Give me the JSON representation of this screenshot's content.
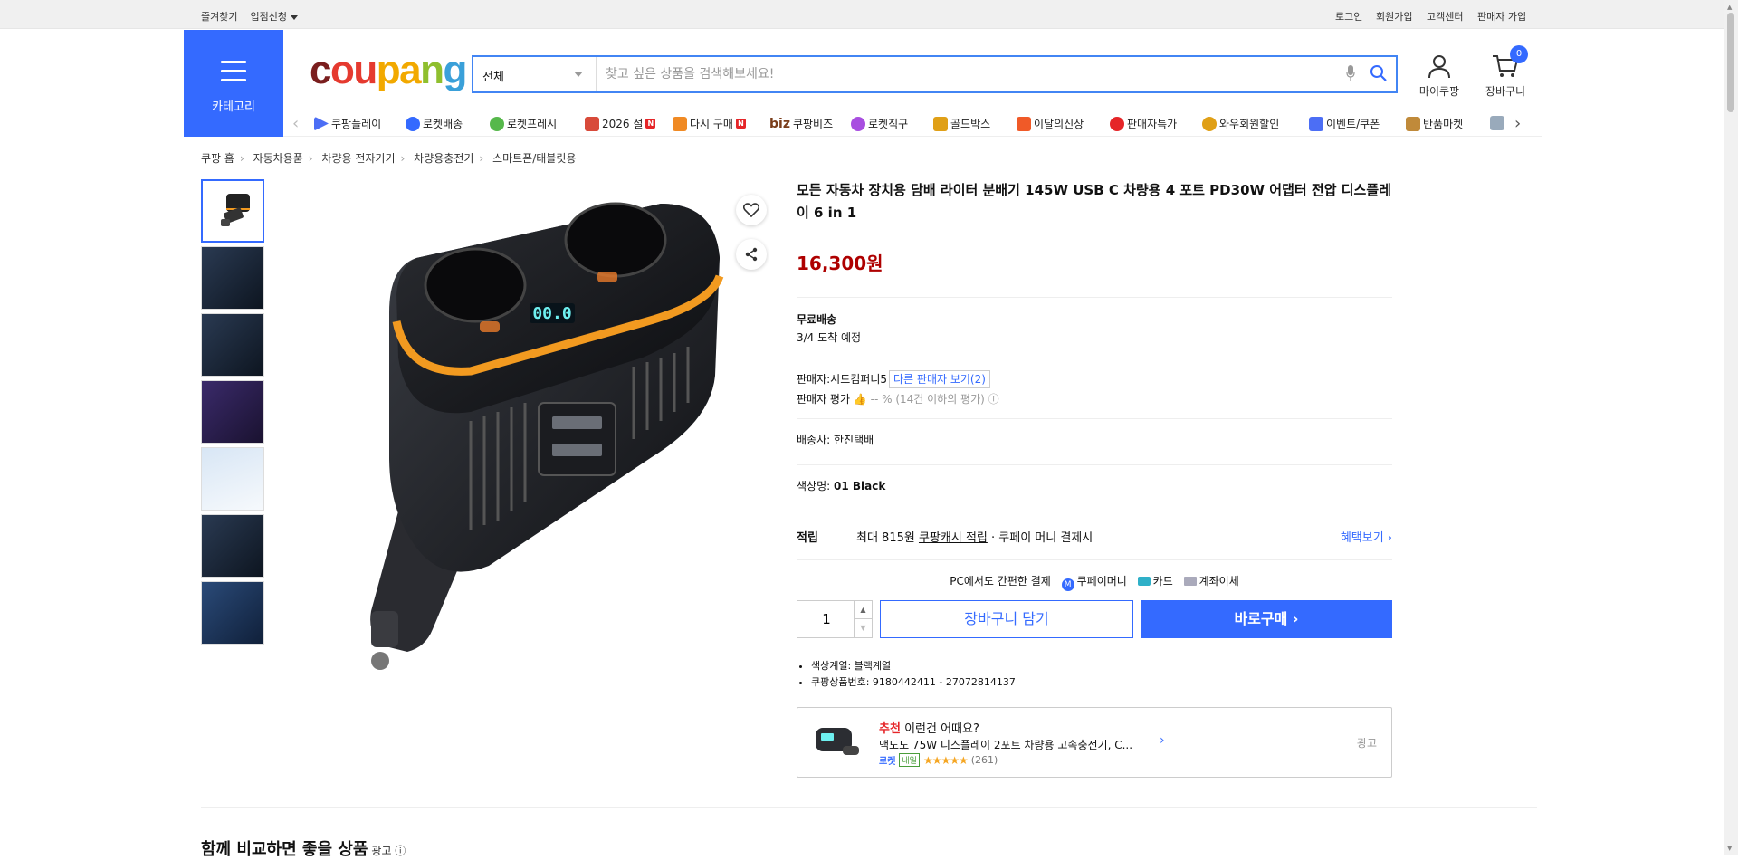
{
  "topbar": {
    "bookmark": "즐겨찾기",
    "join_seller": "입점신청",
    "login": "로그인",
    "signup": "회원가입",
    "customer_center": "고객센터",
    "seller_signup": "판매자 가입"
  },
  "header": {
    "category_label": "카테고리",
    "logo": {
      "p1": "c",
      "p2": "ou",
      "p3": "pa",
      "p4": "n",
      "p5": "g"
    },
    "search_category": "전체",
    "search_placeholder": "찾고 싶은 상품을 검색해보세요!",
    "my_coupang": "마이쿠팡",
    "cart": "장바구니",
    "cart_count": "0"
  },
  "nav": {
    "items": [
      {
        "label": "쿠팡플레이",
        "color": "#4c6ef5"
      },
      {
        "label": "로켓배송",
        "color": "#346aff"
      },
      {
        "label": "로켓프레시",
        "color": "#56b84b"
      },
      {
        "label": "2026 설",
        "color": "#d84a3a"
      },
      {
        "label": "다시 구매",
        "color": "#f08a24"
      },
      {
        "label": "쿠팡비즈",
        "color": "#7a3d1a"
      },
      {
        "label": "로켓직구",
        "color": "#a84ee0"
      },
      {
        "label": "골드박스",
        "color": "#e0a017"
      },
      {
        "label": "이달의신상",
        "color": "#f05a28"
      },
      {
        "label": "판매자특가",
        "color": "#e52528"
      },
      {
        "label": "와우회원할인",
        "color": "#e0a017"
      },
      {
        "label": "이벤트/쿠폰",
        "color": "#4c6ef5"
      },
      {
        "label": "반품마켓",
        "color": "#c08a3a"
      }
    ],
    "new_badge": "N",
    "biz_prefix": "biz"
  },
  "breadcrumb": [
    "쿠팡 홈",
    "자동차용품",
    "차량용 전자기기",
    "차량용충전기",
    "스마트폰/태블릿용"
  ],
  "product": {
    "title": "모든 자동차 장치용 담배 라이터 분배기 145W USB C 차량용 4 포트 PD30W 어댑터 전압 디스플레이 6 in 1",
    "price": "16,300원",
    "shipping_label": "무료배송",
    "arrival": "3/4 도착 예정",
    "seller_label": "판매자:",
    "seller_name": "시드컴퍼니5",
    "other_sellers": "다른 판매자 보기(2)",
    "seller_rating_label": "판매자 평가",
    "seller_rating_value": "-- % (14건 이하의 평가)",
    "courier_label": "배송사:",
    "courier": "한진택배",
    "color_label": "색상명:",
    "color": "01 Black",
    "benefit_label": "적립",
    "benefit_prefix": "최대 815원",
    "benefit_link": "쿠팡캐시 적립",
    "benefit_suffix": "· 쿠페이 머니 결제시",
    "benefit_more": "혜택보기 ›",
    "pay_text": "PC에서도 간편한 결제",
    "pay_coupay": "쿠페이머니",
    "pay_card": "카드",
    "pay_bank": "계좌이체",
    "qty": "1",
    "cart_button": "장바구니 담기",
    "buy_button": "바로구매 ›",
    "spec_color": "색상계열: 블랙계열",
    "spec_id": "쿠팡상품번호: 9180442411 - 27072814137"
  },
  "recommend": {
    "highlight": "추천",
    "title": "이런건 어때요?",
    "name": "맥도도 75W 디스플레이 2포트 차량용 고속충전기, C...",
    "rocket": "로켓",
    "tomorrow": "내일",
    "stars": "★★★★★",
    "count": "(261)",
    "ad": "광고"
  },
  "compare": {
    "title": "함께 비교하면 좋을 상품",
    "ad": "광고 ⓘ"
  },
  "colors": {
    "accent": "#346aff",
    "price": "#ae0000"
  }
}
